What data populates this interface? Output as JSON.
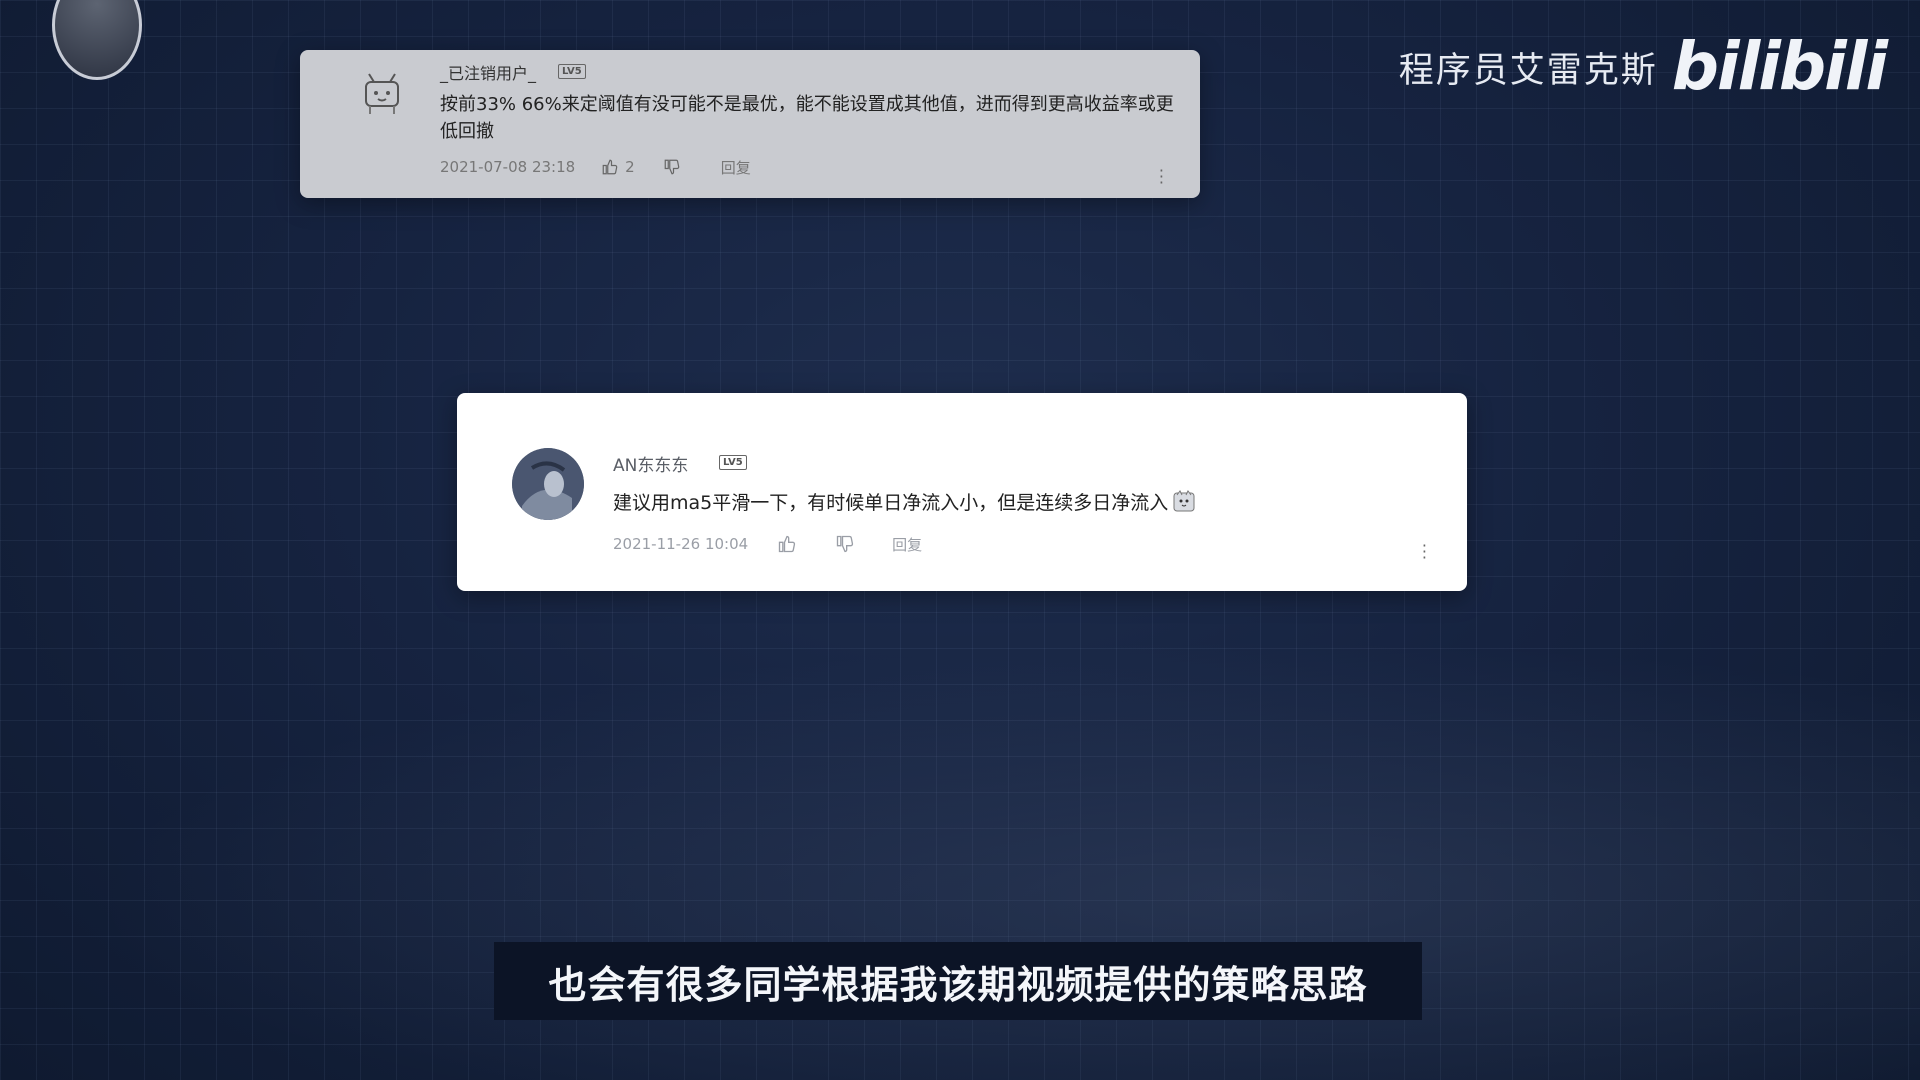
{
  "brand": {
    "name": "程序员艾雷克斯",
    "logo_text": "bilibili"
  },
  "comments": [
    {
      "username": "_已注销用户_",
      "level": "LV5",
      "text": "按前33%  66%来定阈值有没可能不是最优，能不能设置成其他值，进而得到更高收益率或更低回撤",
      "date": "2021-07-08 23:18",
      "likes": "2",
      "reply_label": "回复",
      "avatar_icon": "tv-mascot-avatar-icon"
    },
    {
      "username": "AN东东东",
      "level": "LV5",
      "text": "建议用ma5平滑一下，有时候单日净流入小，但是连续多日净流入",
      "date": "2021-11-26 10:04",
      "likes": "",
      "reply_label": "回复",
      "avatar_icon": "user-photo-avatar-icon",
      "emoji_icon": "cat-emoji-icon"
    }
  ],
  "subtitle": "也会有很多同学根据我该期视频提供的策略思路"
}
